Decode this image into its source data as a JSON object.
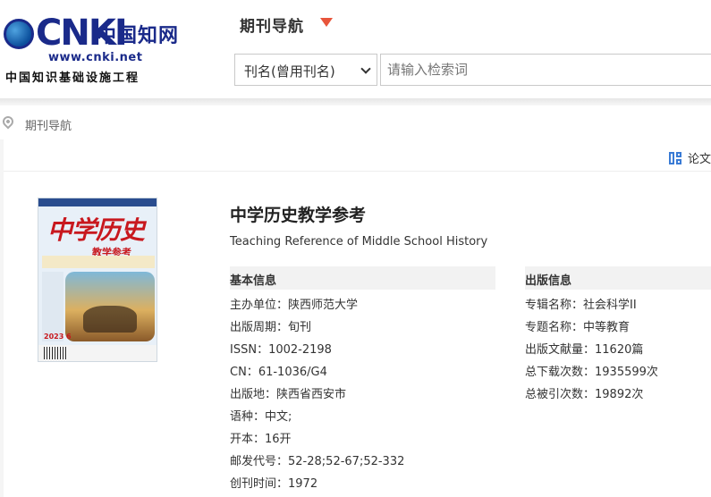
{
  "logo": {
    "mark": "CNKI",
    "cn_name": "中国知网",
    "url": "www.cnki.net",
    "subtitle": "中国知识基础设施工程"
  },
  "nav": {
    "title": "期刊导航"
  },
  "search": {
    "field_selected": "刊名(曾用刊名)",
    "placeholder": "请输入检索词"
  },
  "breadcrumb": {
    "current": "期刊导航"
  },
  "toolbar": {
    "paper_link": "论文"
  },
  "journal": {
    "title_cn": "中学历史教学参考",
    "title_en": "Teaching Reference of Middle School History",
    "cover": {
      "title_line1": "中学历史",
      "title_line2": "教学参考",
      "issue": "2023 6"
    }
  },
  "basic_info": {
    "heading": "基本信息",
    "items": [
      {
        "label": "主办单位：",
        "value": "陕西师范大学"
      },
      {
        "label": "出版周期：",
        "value": "旬刊"
      },
      {
        "label": "ISSN：",
        "value": "1002-2198"
      },
      {
        "label": "CN：",
        "value": "61-1036/G4"
      },
      {
        "label": "出版地：",
        "value": "陕西省西安市"
      },
      {
        "label": "语种：",
        "value": "中文;"
      },
      {
        "label": "开本：",
        "value": "16开"
      },
      {
        "label": "邮发代号：",
        "value": "52-28;52-67;52-332"
      },
      {
        "label": "创刊时间：",
        "value": "1972"
      }
    ]
  },
  "pub_info": {
    "heading": "出版信息",
    "items": [
      {
        "label": "专辑名称：",
        "value": "社会科学II"
      },
      {
        "label": "专题名称：",
        "value": "中等教育"
      },
      {
        "label": "出版文献量：",
        "value": "11620篇"
      },
      {
        "label": "总下载次数：",
        "value": "1935599次"
      },
      {
        "label": "总被引次数：",
        "value": "19892次"
      }
    ]
  },
  "colors": {
    "accent_caret": "#e8553b",
    "logo_blue": "#1a2a8a",
    "link_icon_blue": "#3a7bd5"
  }
}
